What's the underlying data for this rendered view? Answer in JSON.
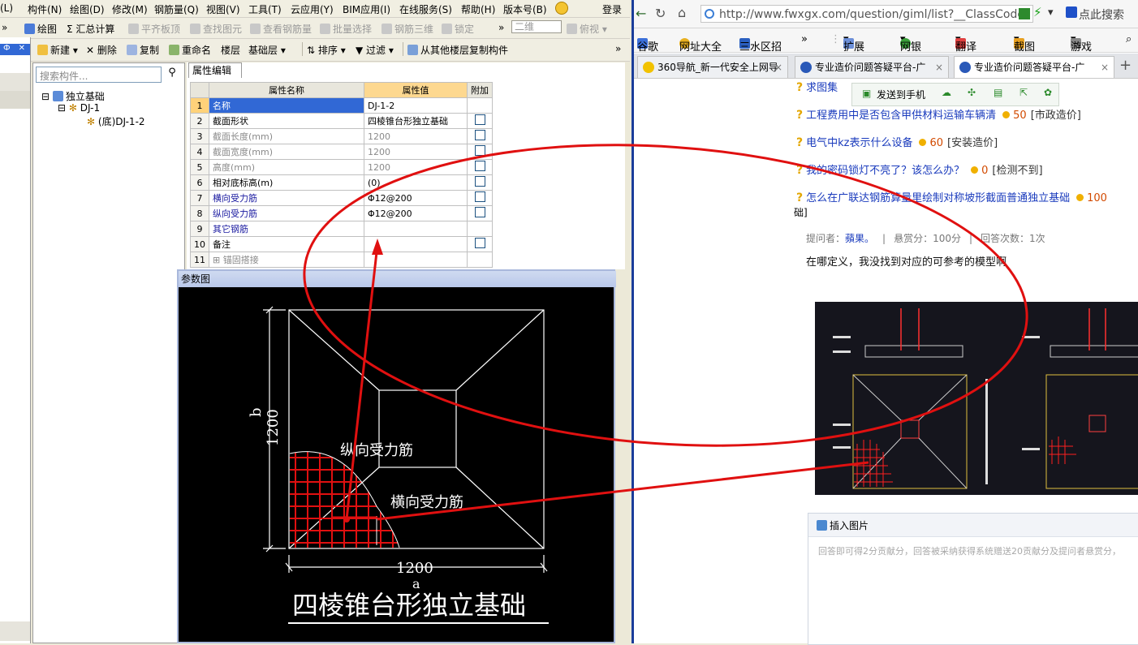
{
  "left_app": {
    "menu": [
      "(L)",
      "构件(N)",
      "绘图(D)",
      "修改(M)",
      "钢筋量(Q)",
      "视图(V)",
      "工具(T)",
      "云应用(Y)",
      "BIM应用(I)",
      "在线服务(S)",
      "帮助(H)",
      "版本号(B)"
    ],
    "login_label": "登录",
    "toolbar1": {
      "draw": "绘图",
      "calc": "汇总计算",
      "flat_board": "平齐板顶",
      "find": "查找图元",
      "view_rebar": "查看钢筋量",
      "batch_select": "批量选择",
      "rebar_3d": "钢筋三维",
      "lock": "锁定",
      "view_mode": "二维",
      "view_dir": "俯视"
    },
    "toolbar2": {
      "new": "新建",
      "delete": "删除",
      "copy": "复制",
      "rename": "重命名",
      "floor_label": "楼层",
      "floor_value": "基础层",
      "sort": "排序",
      "filter": "过滤",
      "copy_from_floor": "从其他楼层复制构件"
    },
    "tree": {
      "search_placeholder": "搜索构件...",
      "root": "独立基础",
      "child": "DJ-1",
      "leaf": "(底)DJ-1-2"
    },
    "prop_tab": "属性编辑",
    "prop_headers": {
      "name": "属性名称",
      "value": "属性值",
      "extra": "附加"
    },
    "props": [
      {
        "n": "1",
        "name": "名称",
        "value": "DJ-1-2"
      },
      {
        "n": "2",
        "name": "截面形状",
        "value": "四棱锥台形独立基础"
      },
      {
        "n": "3",
        "name": "截面长度(mm)",
        "value": "1200"
      },
      {
        "n": "4",
        "name": "截面宽度(mm)",
        "value": "1200"
      },
      {
        "n": "5",
        "name": "高度(mm)",
        "value": "1200"
      },
      {
        "n": "6",
        "name": "相对底标高(m)",
        "value": "(0)"
      },
      {
        "n": "7",
        "name": "横向受力筋",
        "value": "Φ12@200"
      },
      {
        "n": "8",
        "name": "纵向受力筋",
        "value": "Φ12@200"
      },
      {
        "n": "9",
        "name": "其它钢筋",
        "value": ""
      },
      {
        "n": "10",
        "name": "备注",
        "value": ""
      },
      {
        "n": "11",
        "name": "锚固搭接",
        "value": ""
      }
    ],
    "diagram": {
      "title": "参数图",
      "label_b": "b",
      "label_b_dim": "1200",
      "label_a": "a",
      "label_a_dim": "1200",
      "label_long_rebar": "纵向受力筋",
      "label_trans_rebar": "横向受力筋",
      "caption": "四棱锥台形独立基础"
    }
  },
  "browser": {
    "url": "http://www.fwxgx.com/question/giml/list?__ClassCode",
    "search_hint": "点此搜索",
    "bookmarks": [
      "谷歌",
      "网址大全",
      "三水区招",
      "扩展",
      "网银",
      "翻译",
      "截图",
      "游戏"
    ],
    "tabs": [
      {
        "label": "360导航_新一代安全上网导"
      },
      {
        "label": "专业造价问题答疑平台-广"
      },
      {
        "label": "专业造价问题答疑平台-广"
      }
    ],
    "share_bar": {
      "send_to_phone": "发送到手机"
    },
    "questions": [
      {
        "title": "求图集",
        "score": "",
        "category": ""
      },
      {
        "title": "工程费用中是否包含甲供材料运输车辆清",
        "score": "50",
        "category": "[市政造价]"
      },
      {
        "title": "电气中kz表示什么设备",
        "score": "60",
        "category": "[安装造价]"
      },
      {
        "title": "我的密码锁灯不亮了？该怎么办？",
        "score": "0",
        "category": "[检测不到]"
      },
      {
        "title": "怎么在广联达钢筋算量里绘制对称坡形截面普通独立基础",
        "score": "100",
        "category": ""
      }
    ],
    "q_wrap_tail": "础]",
    "meta": {
      "asker_label": "提问者：",
      "asker": "蘋果。",
      "reward": "悬赏分：100分",
      "reply_count": "回答次数：1次"
    },
    "question_body": "在哪定义，我没找到对应的可参考的模型啊",
    "answer": {
      "insert_image": "插入图片",
      "placeholder": "回答即可得2分贡献分，回答被采纳获得系统赠送20贡献分及提问者悬赏分，"
    }
  },
  "colors": {
    "annotation_red": "#e01010",
    "selection_blue": "#3168d5",
    "value_header": "#fdd890"
  }
}
